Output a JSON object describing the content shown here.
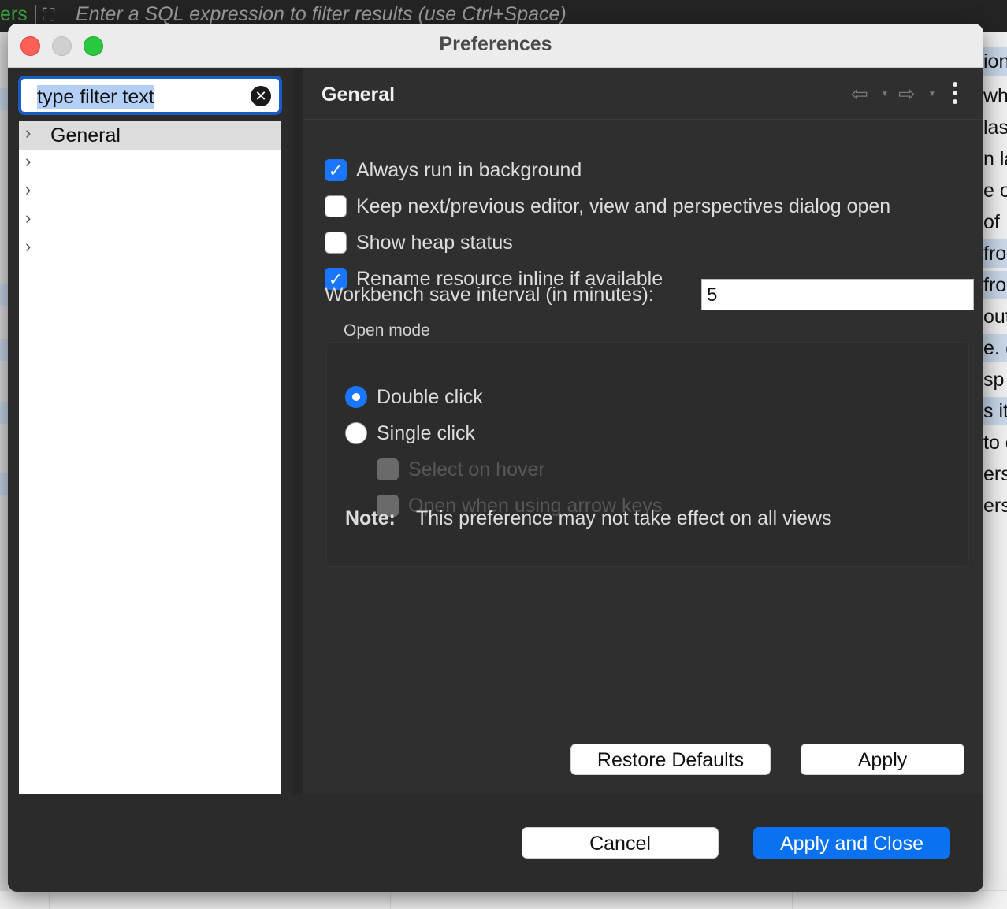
{
  "background_app": {
    "filter_placeholder": "Enter a SQL expression to filter results (use Ctrl+Space)",
    "left_fragment": "ers",
    "right_column_fragments": [
      "ion",
      "wh",
      "las",
      "n la",
      "e on",
      "of",
      "fro",
      "fro",
      "out",
      "e. (",
      "sp",
      "s it",
      "to c",
      "ers",
      "ers"
    ]
  },
  "dialog": {
    "title": "Preferences",
    "filter": {
      "value": "type filter text",
      "clear_icon": "clear-circle-x"
    },
    "tree": {
      "items": [
        {
          "label": "General",
          "selected": true
        },
        {
          "label": "",
          "selected": false
        },
        {
          "label": "",
          "selected": false
        },
        {
          "label": "",
          "selected": false
        },
        {
          "label": "",
          "selected": false
        }
      ]
    },
    "page": {
      "title": "General",
      "options": [
        {
          "label": "Always run in background",
          "checked": true
        },
        {
          "label": "Keep next/previous editor, view and perspectives dialog open",
          "checked": false
        },
        {
          "label": "Show heap status",
          "checked": false
        },
        {
          "label": "Rename resource inline if available",
          "checked": true
        }
      ],
      "interval_label": "Workbench save interval (in minutes):",
      "interval_value": "5",
      "open_mode": {
        "title": "Open mode",
        "radios": [
          {
            "label": "Double click",
            "selected": true
          },
          {
            "label": "Single click",
            "selected": false
          }
        ],
        "sub_options": [
          {
            "label": "Select on hover",
            "enabled": false
          },
          {
            "label": "Open when using arrow keys",
            "enabled": false
          }
        ],
        "note_label": "Note:",
        "note_text": "This preference may not take effect on all views"
      },
      "restore_defaults": "Restore Defaults",
      "apply": "Apply"
    },
    "footer": {
      "cancel": "Cancel",
      "apply_and_close": "Apply and Close"
    },
    "colors": {
      "accent": "#0a72f0",
      "close": "#fe5f57",
      "minimize": "#d0d0d0",
      "maximize": "#28c840"
    }
  }
}
